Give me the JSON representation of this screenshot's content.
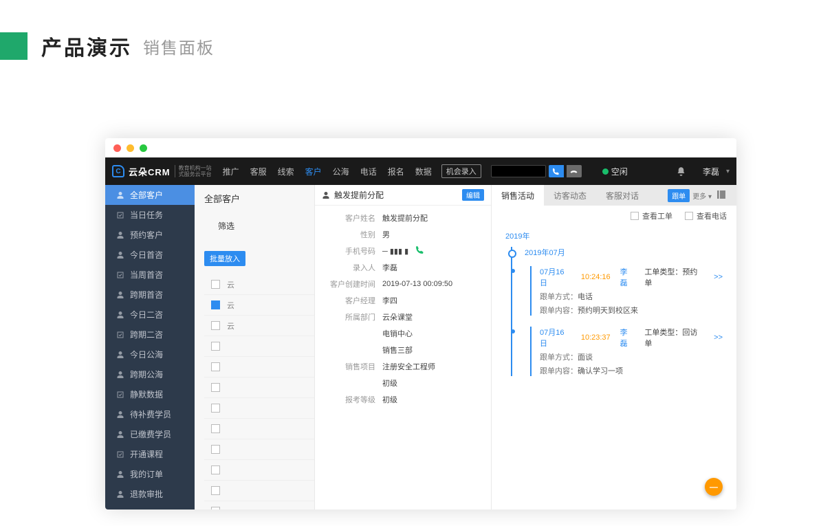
{
  "page": {
    "title_strong": "产品演示",
    "title_sub": "销售面板"
  },
  "topnav": {
    "logo": "云朵CRM",
    "logo_sub1": "教育机构一站",
    "logo_sub2": "式服务云平台",
    "items": [
      "推广",
      "客服",
      "线索",
      "客户",
      "公海",
      "电话",
      "报名",
      "数据"
    ],
    "active_index": 3,
    "opportunity": "机会录入",
    "status": "空闲",
    "username": "李磊"
  },
  "sidebar": {
    "items": [
      "全部客户",
      "当日任务",
      "预约客户",
      "今日首咨",
      "当周首咨",
      "跨期首咨",
      "今日二咨",
      "跨期二咨",
      "今日公海",
      "跨期公海",
      "静默数据",
      "待补费学员",
      "已缴费学员",
      "开通课程",
      "我的订单",
      "退款审批"
    ],
    "active_index": 0
  },
  "main": {
    "heading": "全部客户",
    "filter": "筛选",
    "batch": "批量放入",
    "rows": [
      "云",
      "云",
      "云"
    ]
  },
  "detail": {
    "title": "触发提前分配",
    "edit": "编辑",
    "fields": [
      {
        "lab": "客户姓名",
        "val": "触发提前分配"
      },
      {
        "lab": "性别",
        "val": "男"
      },
      {
        "lab": "手机号码",
        "val": "─  ▮▮▮ ▮",
        "phone": true
      },
      {
        "lab": "录入人",
        "val": "李磊"
      },
      {
        "lab": "客户创建时间",
        "val": "2019-07-13 00:09:50"
      },
      {
        "lab": "客户经理",
        "val": "李四"
      },
      {
        "lab": "所属部门",
        "val": "云朵课堂"
      },
      {
        "lab": "",
        "val": "电销中心"
      },
      {
        "lab": "",
        "val": "销售三部"
      },
      {
        "lab": "销售项目",
        "val": "注册安全工程师"
      },
      {
        "lab": "",
        "val": "初级"
      },
      {
        "lab": "报考等级",
        "val": "初级"
      }
    ]
  },
  "activity": {
    "tabs": [
      "销售活动",
      "访客动态",
      "客服对话"
    ],
    "active_index": 0,
    "trace": "跟单",
    "more": "更多 ▾",
    "toolbar": {
      "view_order": "查看工单",
      "view_call": "查看电话"
    },
    "year": "2019年",
    "month": "2019年07月",
    "cards": [
      {
        "date": "07月16日",
        "time": "10:24:16",
        "who": "李磊",
        "type_k": "工单类型：",
        "type_v": "预约单",
        "rows": [
          {
            "k": "跟单方式：",
            "v": "电话"
          },
          {
            "k": "跟单内容：",
            "v": "预约明天到校区来"
          }
        ]
      },
      {
        "date": "07月16日",
        "time": "10:23:37",
        "who": "李磊",
        "type_k": "工单类型：",
        "type_v": "回访单",
        "rows": [
          {
            "k": "跟单方式：",
            "v": "面谈"
          },
          {
            "k": "跟单内容：",
            "v": "确认学习一项"
          }
        ]
      }
    ],
    "expand": ">>"
  },
  "fab": "—"
}
